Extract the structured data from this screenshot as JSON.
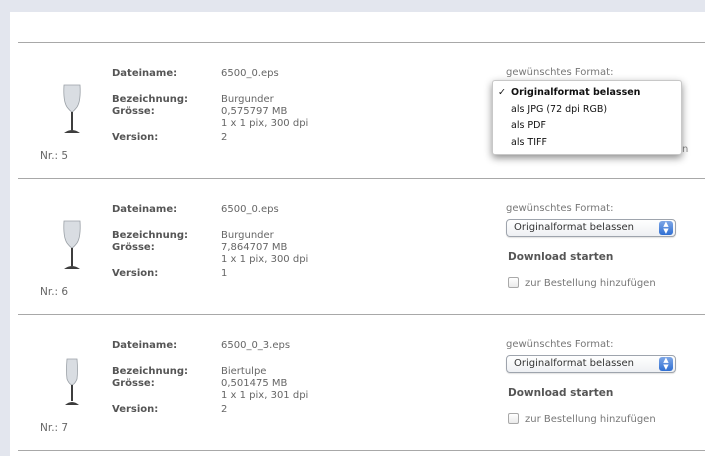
{
  "labels": {
    "filename": "Dateiname:",
    "designation": "Bezeichnung:",
    "size": "Grösse:",
    "version": "Version:",
    "format": "gewünschtes Format:",
    "download": "Download starten",
    "add_to_order": "zur Bestellung hinzufügen"
  },
  "format_options": [
    "Originalformat belassen",
    "als JPG (72 dpi RGB)",
    "als PDF",
    "als TIFF"
  ],
  "format_tail": "n",
  "items": [
    {
      "nr": "Nr.: 5",
      "filename": "6500_0.eps",
      "designation": "Burgunder",
      "size_mb": "0,575797 MB",
      "dimensions": "1 x 1 pix, 300 dpi",
      "version": "2",
      "selected_format": "Originalformat belassen",
      "glass_icon": "wine-glass-icon"
    },
    {
      "nr": "Nr.: 6",
      "filename": "6500_0.eps",
      "designation": "Burgunder",
      "size_mb": "7,864707 MB",
      "dimensions": "1 x 1 pix, 300 dpi",
      "version": "1",
      "selected_format": "Originalformat belassen",
      "glass_icon": "wine-glass-icon"
    },
    {
      "nr": "Nr.: 7",
      "filename": "6500_0_3.eps",
      "designation": "Biertulpe",
      "size_mb": "0,501475 MB",
      "dimensions": "1 x 1 pix, 301 dpi",
      "version": "2",
      "selected_format": "Originalformat belassen",
      "glass_icon": "beer-tulip-glass-icon"
    }
  ]
}
